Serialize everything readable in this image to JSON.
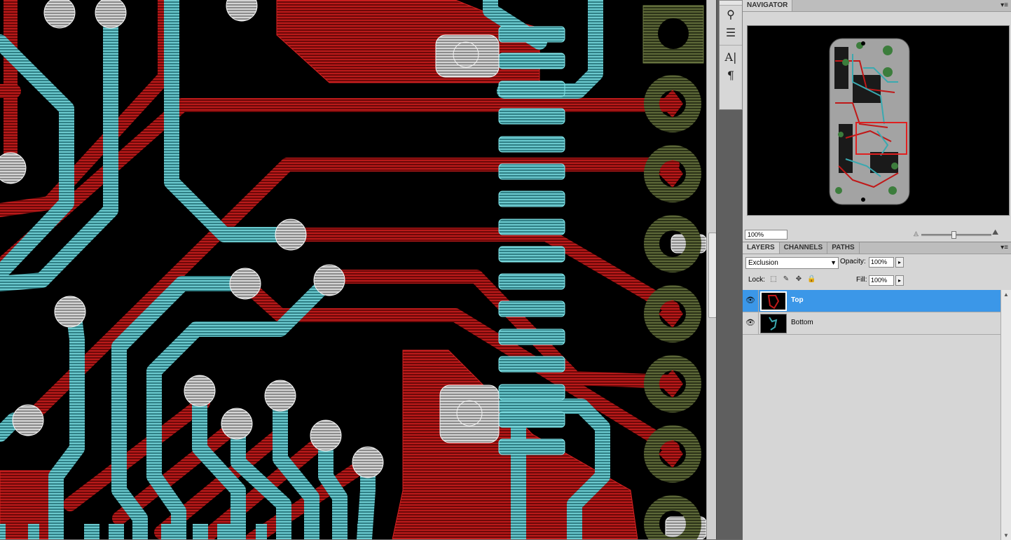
{
  "navigator": {
    "tabs": [
      "NAVIGATOR"
    ],
    "menu_icon": "panel-menu-icon",
    "zoom_value": "100%",
    "zoom_out_icon": "mountain-small-icon",
    "zoom_in_icon": "mountain-large-icon"
  },
  "layers": {
    "tabs": [
      "LAYERS",
      "CHANNELS",
      "PATHS"
    ],
    "blend_mode": "Exclusion",
    "opacity_label": "Opacity:",
    "opacity_value": "100%",
    "lock_label": "Lock:",
    "fill_label": "Fill:",
    "fill_value": "100%",
    "items": [
      {
        "name": "Top",
        "visible": true,
        "selected": true
      },
      {
        "name": "Bottom",
        "visible": true,
        "selected": false
      }
    ]
  },
  "tools": {
    "icons": [
      "clone-source-icon",
      "tool-presets-icon",
      "character-icon",
      "paragraph-icon"
    ]
  },
  "colors": {
    "top_layer": "#c01818",
    "bottom_layer": "#5fc8cc",
    "pads": "#55603a",
    "selection": "#3b97e8"
  }
}
